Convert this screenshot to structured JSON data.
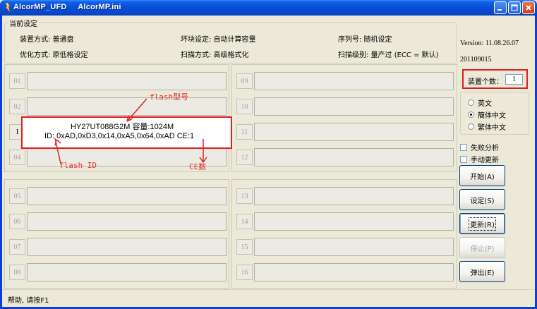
{
  "window": {
    "title": "AlcorMP_UFD     AlcorMP.ini",
    "buttons": [
      "minimize-icon",
      "maximize-icon",
      "close-icon"
    ]
  },
  "settings": {
    "group_title": "当前设定",
    "device_mode": "装置方式: 普通盘",
    "optimize_mode": "优化方式: 原低格设定",
    "badblock_setting": "坏块设定: 自动计算容量",
    "scan_mode": "扫描方式: 高级格式化",
    "serial_setting": "序列号: 随机设定",
    "scan_level": "扫描级别: 量产过 (ECC = 默认)"
  },
  "slots": {
    "left_top": [
      "01",
      "02",
      "",
      "04"
    ],
    "left_bottom": [
      "05",
      "06",
      "07",
      "08"
    ],
    "right_top": [
      "09",
      "10",
      "11",
      "12"
    ],
    "right_bottom": [
      "13",
      "14",
      "15",
      "16"
    ],
    "hidden_slot_fragment": "I"
  },
  "sidebar": {
    "version": "Version: 11.08.26.07",
    "build": "201109015",
    "device_count_label": "装置个数：",
    "device_count_value": "1",
    "languages": [
      {
        "label": "英文",
        "selected": false
      },
      {
        "label": "簡体中文",
        "selected": true
      },
      {
        "label": "繁体中文",
        "selected": false
      }
    ],
    "checkboxes": [
      {
        "label": "失败分析",
        "checked": false
      },
      {
        "label": "手动更新",
        "checked": false
      }
    ],
    "buttons": {
      "start": "开始(A)",
      "settings": "设定(S)",
      "update": "更新(R)",
      "stop": "停止(P)",
      "eject": "弹出(E)"
    }
  },
  "status_bar": "帮助, 请按F1",
  "annotation": {
    "popup_line1": "HY27UT088G2M 容量:1024M",
    "popup_line2": "ID: 0xAD,0xD3,0x14,0xA5,0x64,0xAD  CE:1",
    "label_flash_model": "flash型号",
    "label_flash_id": "flash ID",
    "label_ce": "CE数",
    "color": "#e02020"
  }
}
